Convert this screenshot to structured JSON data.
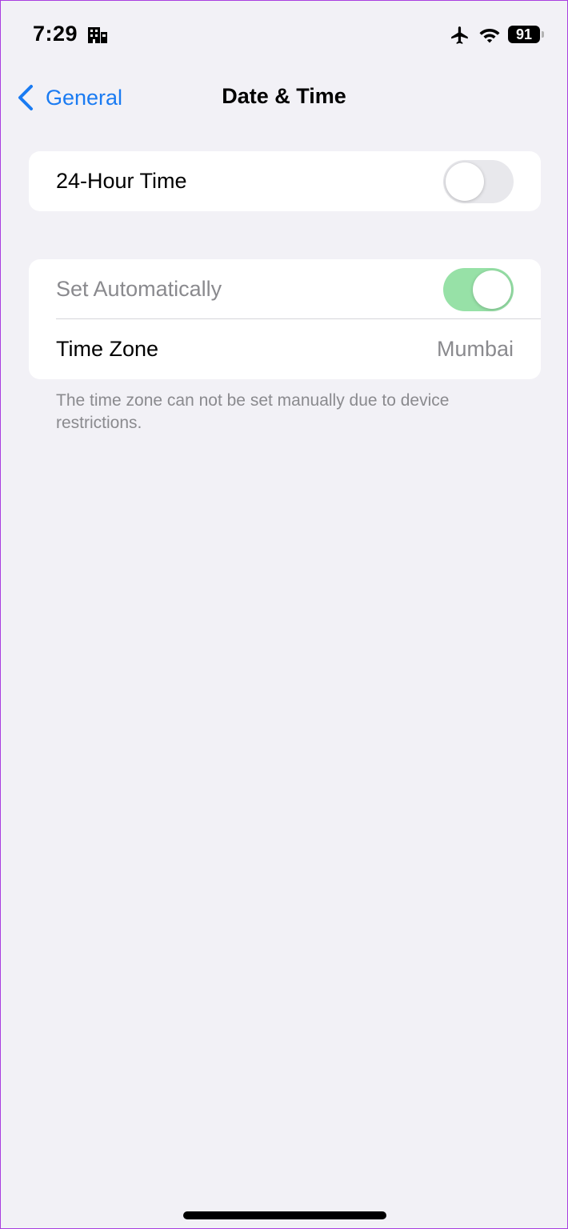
{
  "status_bar": {
    "time": "7:29",
    "battery": "91",
    "icons": [
      "building-icon",
      "airplane-icon",
      "wifi-icon",
      "battery-icon"
    ]
  },
  "nav": {
    "back_label": "General",
    "title": "Date & Time",
    "back_icon": "chevron-left-icon"
  },
  "group1": {
    "hour24_label": "24-Hour Time",
    "hour24_on": false
  },
  "group2": {
    "set_auto_label": "Set Automatically",
    "set_auto_on": true,
    "timezone_label": "Time Zone",
    "timezone_value": "Mumbai"
  },
  "footer_note": "The time zone can not be set manually due to device restrictions.",
  "colors": {
    "accent": "#1a7bf2",
    "background": "#f2f1f6",
    "toggle_on": "#97e1a7",
    "toggle_off": "#e8e8ec",
    "secondary_text": "#8a8a8e"
  }
}
